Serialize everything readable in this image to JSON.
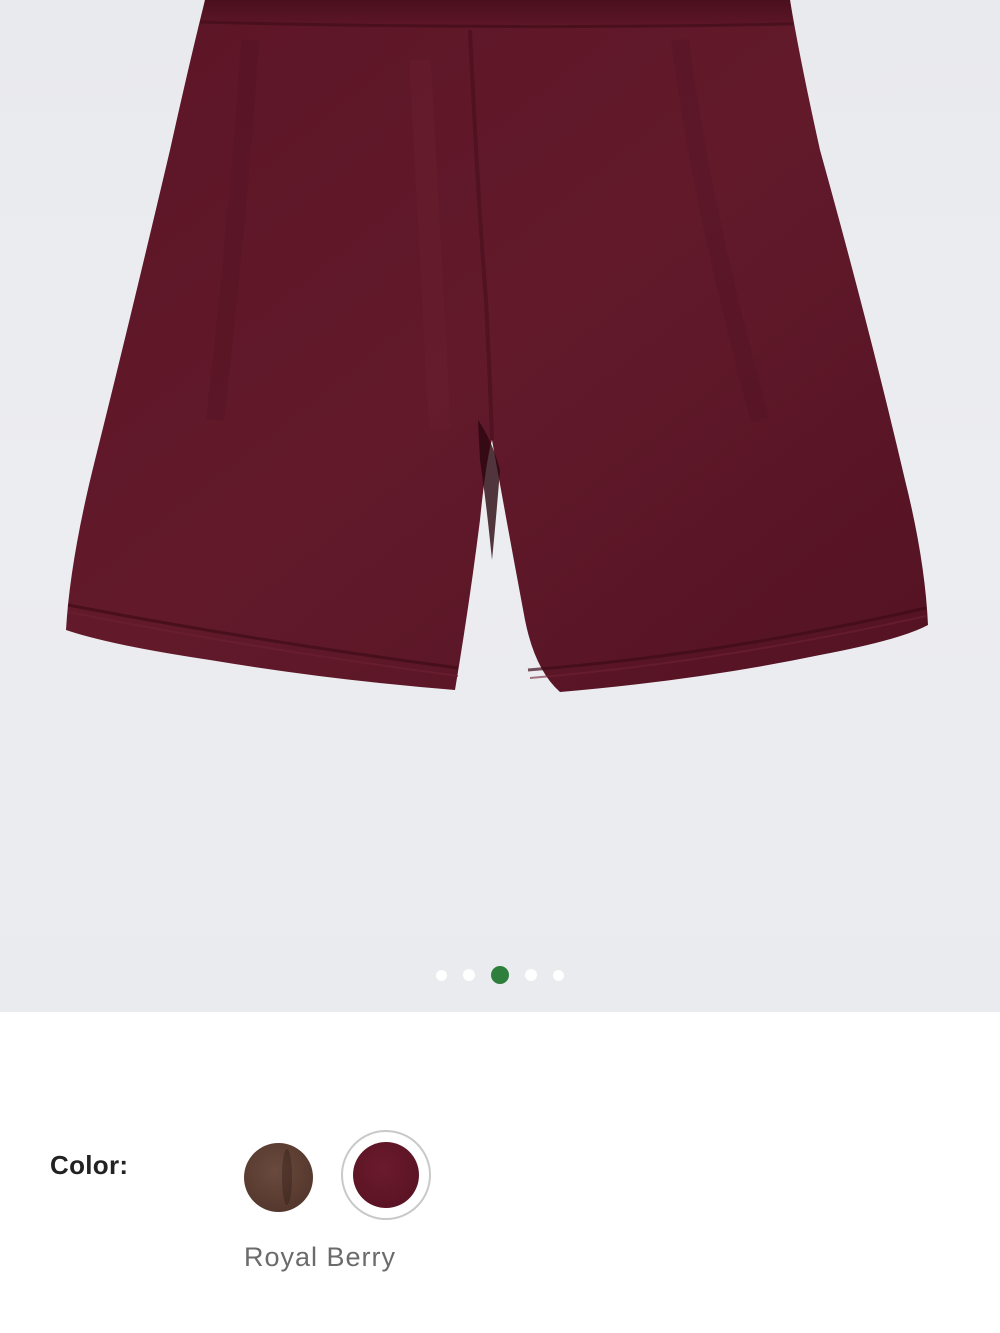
{
  "carousel": {
    "image_icon": "shorts-product-photo",
    "page_count": 5,
    "active_page": 3
  },
  "color_selector": {
    "label": "Color:",
    "selected_name": "Royal Berry",
    "swatches": [
      {
        "color": "#5a3c31",
        "selected": false
      },
      {
        "color": "#5e1526",
        "selected": true
      }
    ]
  },
  "colors": {
    "pager_active": "#2e7f3c",
    "pager_inactive": "#ffffff",
    "product": "#5e1526",
    "background": "#ebecf0"
  }
}
